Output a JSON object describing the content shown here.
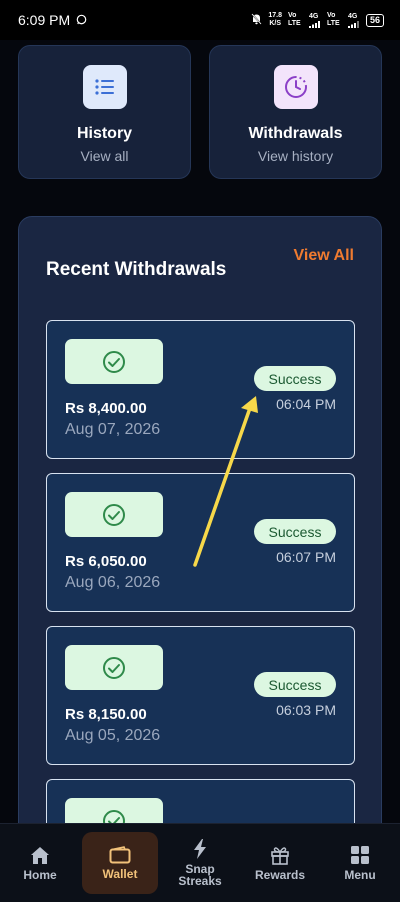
{
  "status_bar": {
    "time": "6:09 PM",
    "net_speed_value": "17.8",
    "net_speed_unit": "K/S",
    "sim1": "Vo LTE",
    "sim2": "Vo LTE",
    "net1": "4G",
    "net2": "4G",
    "battery": "56"
  },
  "quick_actions": [
    {
      "title": "History",
      "subtitle": "View all",
      "icon": "list-icon"
    },
    {
      "title": "Withdrawals",
      "subtitle": "View history",
      "icon": "clock-icon"
    }
  ],
  "recent": {
    "title": "Recent Withdrawals",
    "view_all": "View All",
    "items": [
      {
        "amount": "Rs 8,400.00",
        "date": "Aug 07, 2026",
        "status": "Success",
        "time": "06:04 PM"
      },
      {
        "amount": "Rs 6,050.00",
        "date": "Aug 06, 2026",
        "status": "Success",
        "time": "06:07 PM"
      },
      {
        "amount": "Rs 8,150.00",
        "date": "Aug 05, 2026",
        "status": "Success",
        "time": "06:03 PM"
      }
    ]
  },
  "nav": {
    "active": "Wallet",
    "items": [
      {
        "label": "Home",
        "icon": "home-icon"
      },
      {
        "label": "Wallet",
        "icon": "wallet-icon"
      },
      {
        "label": "Snap Streaks",
        "icon": "lightning-icon"
      },
      {
        "label": "Rewards",
        "icon": "gift-icon"
      },
      {
        "label": "Menu",
        "icon": "grid-icon"
      }
    ]
  },
  "colors": {
    "accent": "#f07b30",
    "success_bg": "#dcf7e1",
    "success_text": "#1c5a32",
    "card_bg": "#173156",
    "annotation_arrow": "#f7d84a"
  }
}
